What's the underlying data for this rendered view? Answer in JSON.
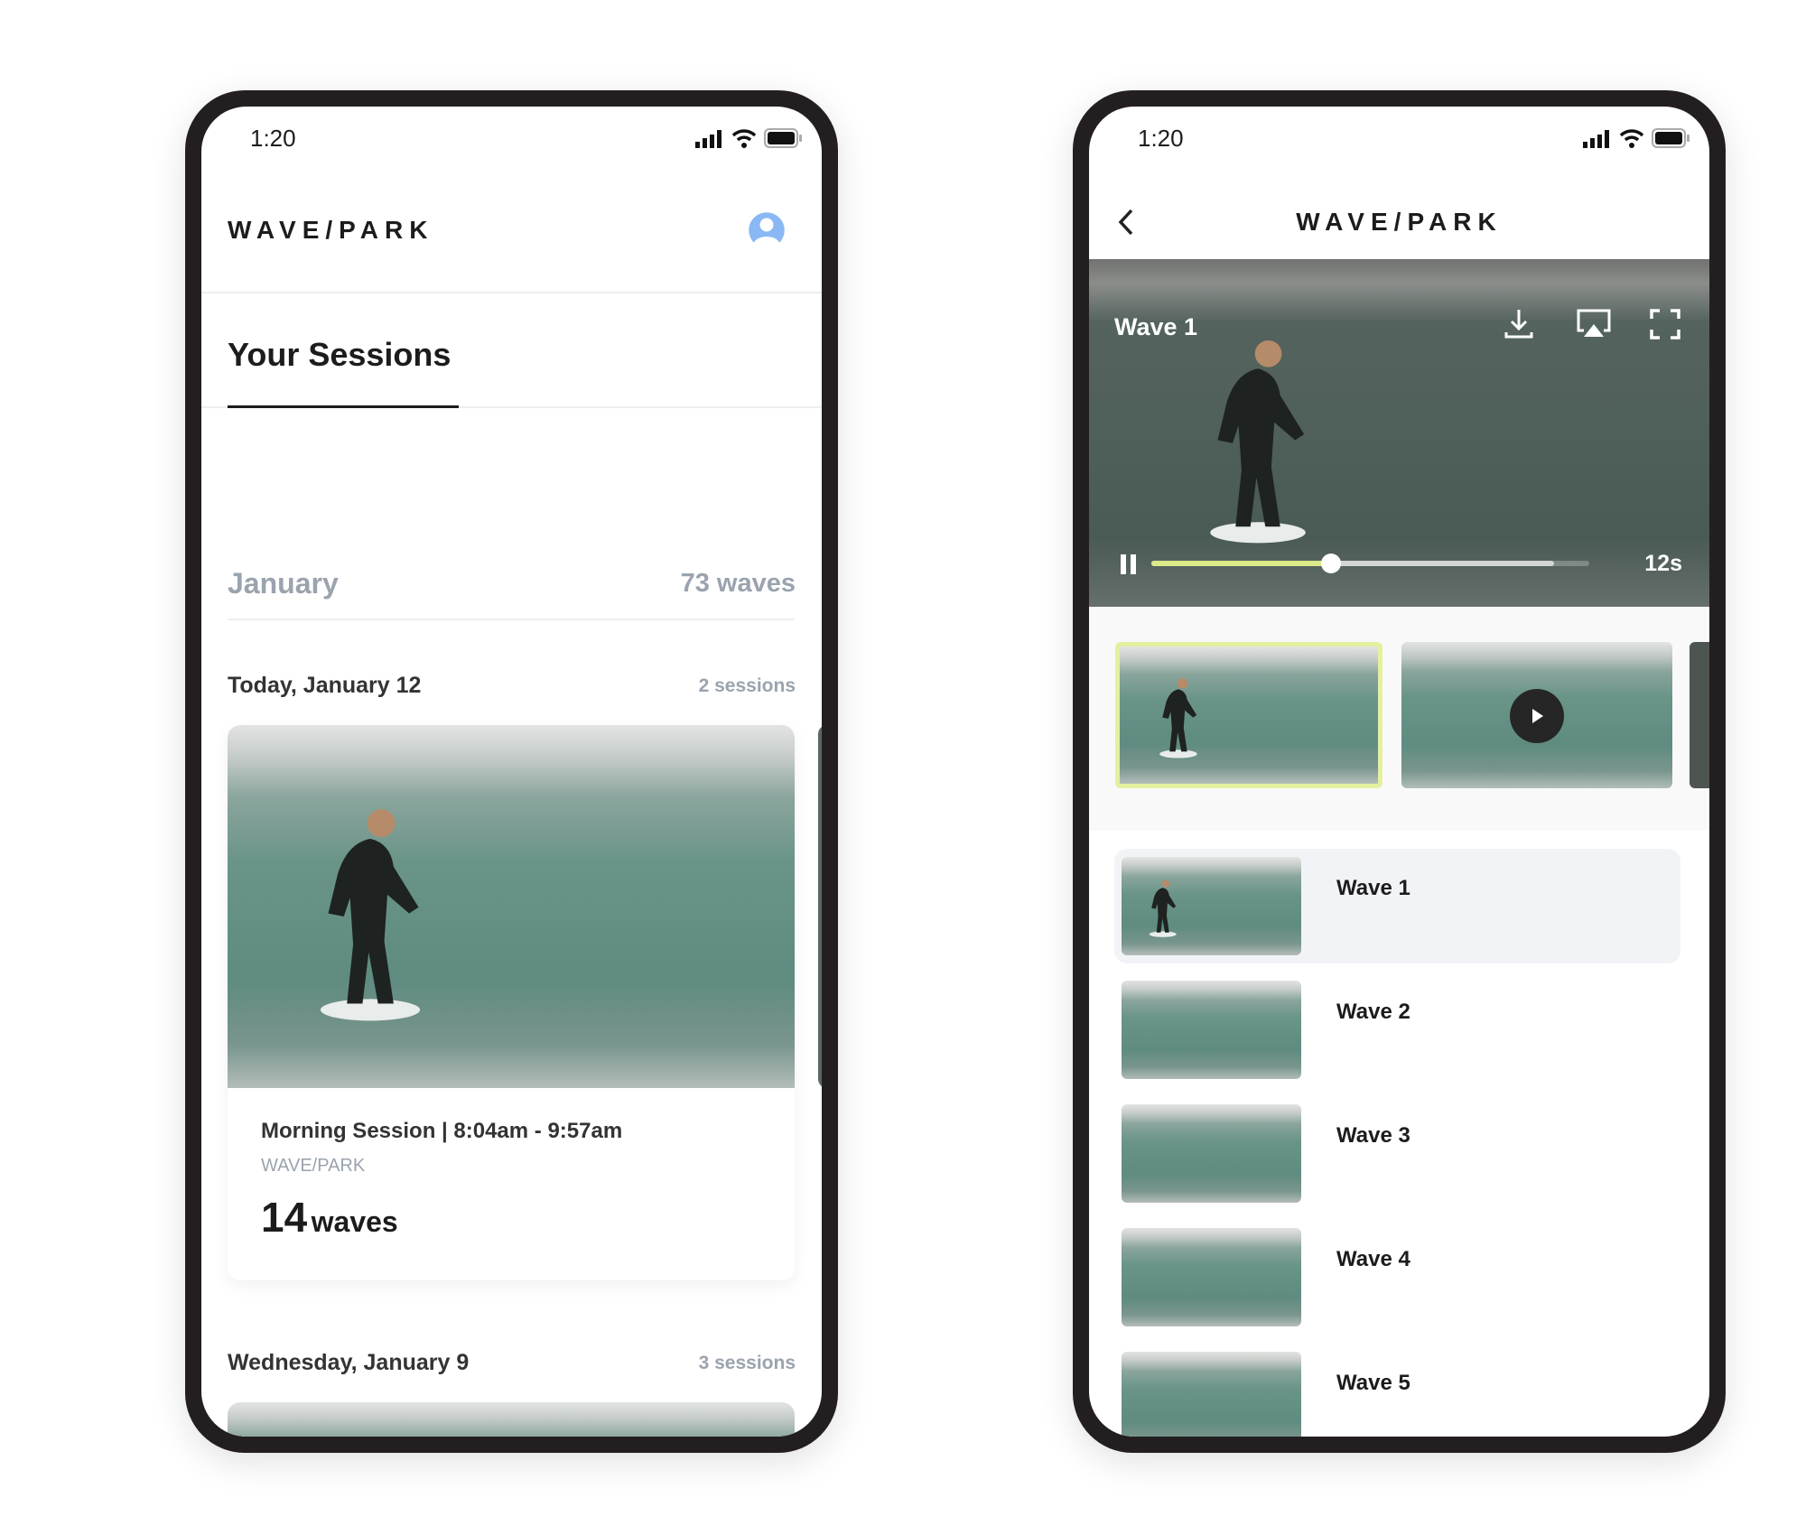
{
  "status_bar": {
    "time": "1:20"
  },
  "sessions_screen": {
    "brand": "WAVE/PARK",
    "tab_label": "Your Sessions",
    "month": {
      "label": "January",
      "count": "73 waves"
    },
    "days": [
      {
        "label": "Today, January 12",
        "sessions": "2 sessions",
        "card": {
          "title": "Morning Session | 8:04am - 9:57am",
          "location": "WAVE/PARK",
          "wave_count": "14",
          "wave_unit": "waves"
        }
      },
      {
        "label": "Wednesday, January 9",
        "sessions": "3 sessions"
      }
    ]
  },
  "player_screen": {
    "brand": "WAVE/PARK",
    "video": {
      "title": "Wave 1",
      "duration": "12s",
      "progress_percent": 41,
      "buffered_percent": 92,
      "state": "playing"
    },
    "waves": [
      {
        "label": "Wave 1",
        "selected": true
      },
      {
        "label": "Wave 2"
      },
      {
        "label": "Wave 3"
      },
      {
        "label": "Wave 4"
      },
      {
        "label": "Wave 5"
      }
    ]
  },
  "colors": {
    "accent": "#dcea8a",
    "avatar": "#8ab8f5",
    "muted": "#9aa3ae",
    "frame": "#231f20"
  },
  "icons": [
    "signal-icon",
    "wifi-icon",
    "battery-icon",
    "avatar-icon",
    "back-chevron-icon",
    "download-icon",
    "airplay-icon",
    "fullscreen-icon",
    "pause-icon",
    "play-icon"
  ]
}
